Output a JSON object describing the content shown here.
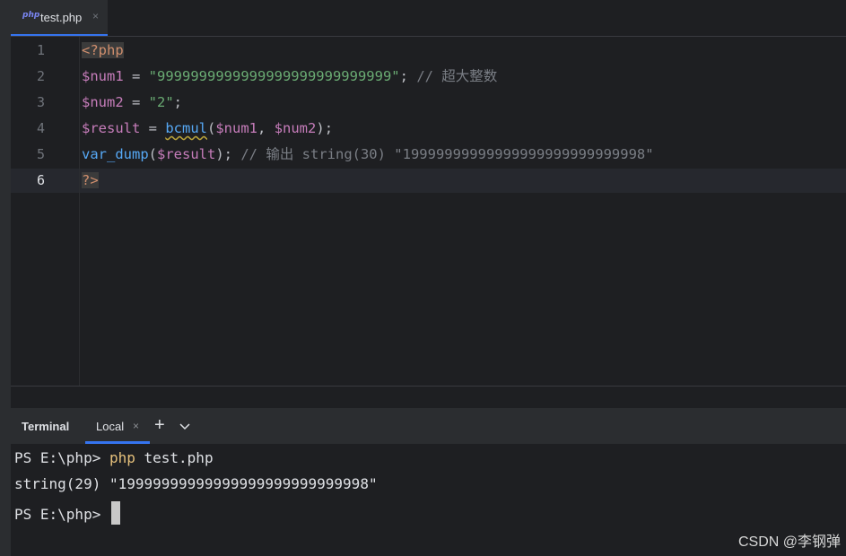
{
  "editor_tab": {
    "icon": "php",
    "label": "test.php",
    "close": "×"
  },
  "code": {
    "line_numbers": [
      "1",
      "2",
      "3",
      "4",
      "5",
      "6"
    ],
    "l1": {
      "open_tag": "<?php"
    },
    "l2": {
      "var": "$num1",
      "assign": " = ",
      "str": "\"9999999999999999999999999999\"",
      "semi": "; ",
      "comment": "// 超大整数"
    },
    "l3": {
      "var": "$num2",
      "assign": " = ",
      "str": "\"2\"",
      "semi": ";"
    },
    "l4": {
      "var": "$result",
      "assign": " = ",
      "fn": "bcmul",
      "open": "(",
      "arg1": "$num1",
      "comma": ", ",
      "arg2": "$num2",
      "close": ");"
    },
    "l5": {
      "fn": "var_dump",
      "open": "(",
      "arg": "$result",
      "close": "); ",
      "comment": "// 输出 string(30) \"19999999999999999999999999998\""
    },
    "l6": {
      "close_tag": "?>"
    }
  },
  "terminal": {
    "title": "Terminal",
    "tab_label": "Local",
    "tab_close": "×",
    "add": "+",
    "dropdown": "⌄",
    "lines": [
      {
        "prompt": "PS E:\\php> ",
        "cmd": "php",
        "args": " test.php"
      },
      {
        "output": "string(29) \"19999999999999999999999999998\""
      },
      {
        "prompt": "PS E:\\php> "
      }
    ]
  },
  "watermark": "CSDN @李钢弹"
}
